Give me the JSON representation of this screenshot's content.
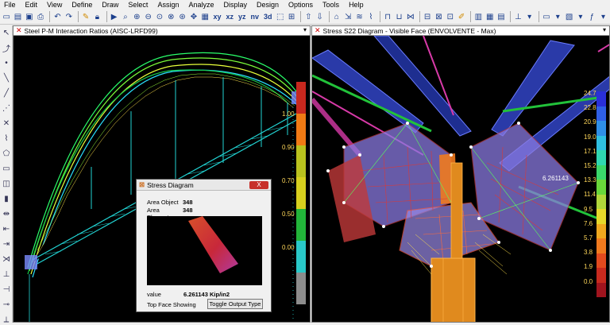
{
  "menu": [
    "File",
    "Edit",
    "View",
    "Define",
    "Draw",
    "Select",
    "Assign",
    "Analyze",
    "Display",
    "Design",
    "Options",
    "Tools",
    "Help"
  ],
  "toolbar": {
    "text_buttons": [
      "xy",
      "xz",
      "yz",
      "nv",
      "3d"
    ]
  },
  "left_pane": {
    "title": "Steel P-M Interaction Ratios  (AISC-LRFD99)",
    "legend": {
      "labels": [
        "1.00",
        "0.90",
        "0.70",
        "0.50",
        "0.00"
      ],
      "colors": [
        "#c8281e",
        "#f07a14",
        "#b9c21e",
        "#d6d01e",
        "#22b53a",
        "#29c8c8",
        "#8c8c8c"
      ]
    }
  },
  "right_pane": {
    "title": "Stress S22 Diagram - Visible Face  (ENVOLVENTE - Max)",
    "annotation": "6.261143",
    "legend": {
      "labels": [
        "24.7",
        "22.8",
        "20.9",
        "19.0",
        "17.1",
        "15.2",
        "13.3",
        "11.4",
        "9.5",
        "7.6",
        "5.7",
        "3.8",
        "1.9",
        "0.0"
      ],
      "colors": [
        "#2a2fd8",
        "#2f5fe6",
        "#2f8fe6",
        "#2fbfe0",
        "#2fd6b0",
        "#3ad66a",
        "#68d63a",
        "#b0d63a",
        "#e6d82a",
        "#f0a81e",
        "#f07a1e",
        "#e24a1e",
        "#c82a1e",
        "#a0141e"
      ]
    }
  },
  "dialog": {
    "title": "Stress Diagram",
    "close_label": "X",
    "area_object_label": "Area Object",
    "area_object_value": "348",
    "area_element_label": "Area Element",
    "area_element_value": "348",
    "value_label": "value",
    "value": "6.261143  Kip/in2",
    "face_label": "Top Face Showing",
    "toggle_button": "Toggle Output Type"
  }
}
